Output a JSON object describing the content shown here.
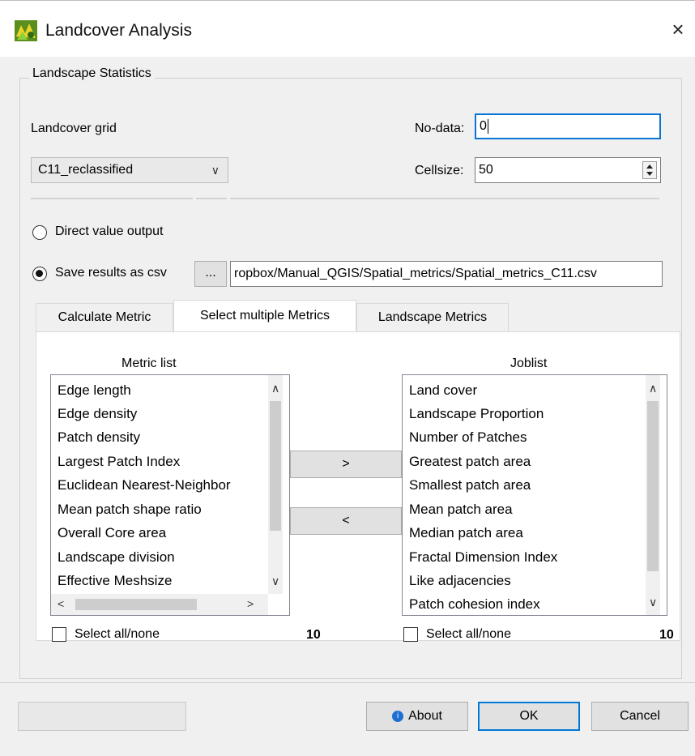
{
  "window": {
    "title": "Landcover Analysis",
    "close_glyph": "×",
    "app_icon": "qgis-plugin-icon"
  },
  "group": {
    "title": "Landscape Statistics"
  },
  "landcover_grid": {
    "label": "Landcover grid",
    "selected": "C11_reclassified",
    "chevron": "∨"
  },
  "nodata": {
    "label": "No-data:",
    "value": "0"
  },
  "cellsize": {
    "label": "Cellsize:",
    "value": "50"
  },
  "output": {
    "direct_label": "Direct value output",
    "direct_checked": false,
    "csv_label": "Save results as csv",
    "csv_checked": true,
    "browse_label": "...",
    "csv_path": "ropbox/Manual_QGIS/Spatial_metrics/Spatial_metrics_C11.csv"
  },
  "tabs": [
    {
      "label": "Calculate Metric",
      "active": false
    },
    {
      "label": "Select multiple Metrics",
      "active": true
    },
    {
      "label": "Landscape Metrics",
      "active": false
    }
  ],
  "metric_list": {
    "header": "Metric list",
    "items": [
      "Edge length",
      "Edge density",
      "Patch density",
      "Largest Patch Index",
      "Euclidean Nearest-Neighbor",
      "Mean patch shape ratio",
      "Overall Core area",
      "Landscape division",
      "Effective Meshsize"
    ],
    "select_all_label": "Select all/none",
    "count": "10"
  },
  "joblist": {
    "header": "Joblist",
    "items": [
      "Land cover",
      "Landscape Proportion",
      "Number of Patches",
      "Greatest patch area",
      "Smallest patch area",
      "Mean patch area",
      "Median patch area",
      "Fractal Dimension Index",
      "Like adjacencies",
      "Patch cohesion index"
    ],
    "select_all_label": "Select all/none",
    "count": "10"
  },
  "transfer": {
    "add_label": ">",
    "remove_label": "<"
  },
  "footer": {
    "about_label": "About",
    "ok_label": "OK",
    "cancel_label": "Cancel",
    "blank_label": ""
  },
  "colors": {
    "focus": "#0a74d6",
    "about_icon": "#1f6fd1",
    "ok_border": "#0078d7"
  }
}
